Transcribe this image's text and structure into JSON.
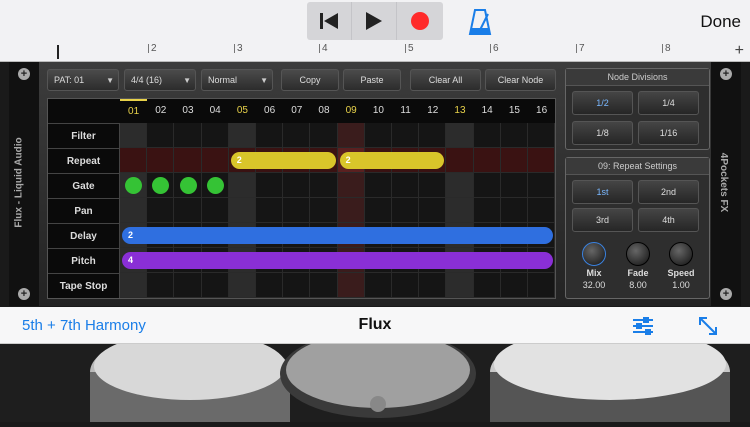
{
  "header": {
    "done_label": "Done"
  },
  "ruler": {
    "marks": [
      "2",
      "3",
      "4",
      "5",
      "6",
      "7",
      "8"
    ]
  },
  "rack": {
    "left_label": "Flux - Liquid Audio",
    "right_label": "4Pockets FX"
  },
  "toolbar": {
    "pattern": "PAT: 01",
    "time_sig": "4/4 (16)",
    "mode": "Normal",
    "copy": "Copy",
    "paste": "Paste",
    "clear_all": "Clear All",
    "clear_node": "Clear Node"
  },
  "grid": {
    "columns": [
      "01",
      "02",
      "03",
      "04",
      "05",
      "06",
      "07",
      "08",
      "09",
      "10",
      "11",
      "12",
      "13",
      "14",
      "15",
      "16"
    ],
    "rows": [
      "Filter",
      "Repeat",
      "Gate",
      "Pan",
      "Delay",
      "Pitch",
      "Tape Stop"
    ],
    "repeat_segments": [
      {
        "label": "2"
      },
      {
        "label": "2"
      }
    ],
    "delay_label": "2",
    "pitch_label": "4"
  },
  "node_divisions": {
    "title": "Node Divisions",
    "buttons": [
      "1/2",
      "1/4",
      "1/8",
      "1/16"
    ]
  },
  "repeat_settings": {
    "title": "09: Repeat Settings",
    "buttons": [
      "1st",
      "2nd",
      "3rd",
      "4th"
    ],
    "knobs": [
      {
        "label": "Mix",
        "value": "32.00"
      },
      {
        "label": "Fade",
        "value": "8.00"
      },
      {
        "label": "Speed",
        "value": "1.00"
      }
    ]
  },
  "plugin_bar": {
    "preset": "5th + 7th Harmony",
    "name": "Flux"
  },
  "colors": {
    "accent": "#1a7ee8",
    "repeat": "#d9c52a",
    "gate": "#35c335",
    "delay": "#2f6fe0",
    "pitch": "#8a2fd6"
  }
}
